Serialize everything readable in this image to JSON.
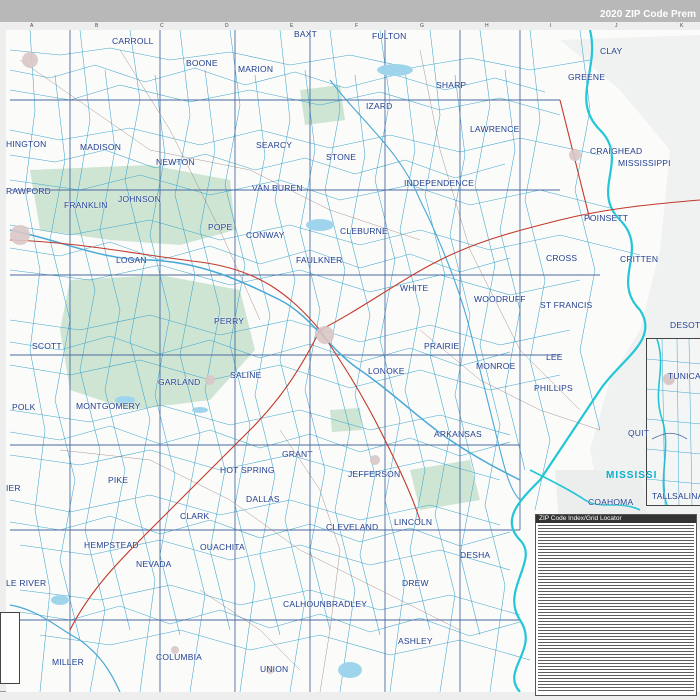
{
  "title": "2020 ZIP Code Prem",
  "grid_letters_top": [
    "A",
    "B",
    "C",
    "D",
    "E",
    "F",
    "G",
    "H",
    "I",
    "J",
    "K"
  ],
  "counties": [
    {
      "id": "carroll",
      "label": "CARROLL"
    },
    {
      "id": "boone",
      "label": "BOONE"
    },
    {
      "id": "marion",
      "label": "MARION"
    },
    {
      "id": "baxter",
      "label": "BAXT"
    },
    {
      "id": "fulton",
      "label": "FULTON"
    },
    {
      "id": "sharp",
      "label": "SHARP"
    },
    {
      "id": "izard",
      "label": "IZARD"
    },
    {
      "id": "greene",
      "label": "GREENE"
    },
    {
      "id": "clay",
      "label": "CLAY"
    },
    {
      "id": "madison",
      "label": "MADISON"
    },
    {
      "id": "washington",
      "label": "HINGTON"
    },
    {
      "id": "newton",
      "label": "NEWTON"
    },
    {
      "id": "searcy",
      "label": "SEARCY"
    },
    {
      "id": "stone",
      "label": "STONE"
    },
    {
      "id": "lawrence",
      "label": "LAWRENCE"
    },
    {
      "id": "craighead",
      "label": "CRAIGHEAD"
    },
    {
      "id": "mississippi",
      "label": "MISSISSIPPI"
    },
    {
      "id": "crawford",
      "label": "RAWFORD"
    },
    {
      "id": "franklin",
      "label": "FRANKLIN"
    },
    {
      "id": "johnson",
      "label": "JOHNSON"
    },
    {
      "id": "van-buren",
      "label": "VAN BUREN"
    },
    {
      "id": "independence",
      "label": "INDEPENDENCE"
    },
    {
      "id": "poinsett",
      "label": "POINSETT"
    },
    {
      "id": "pope",
      "label": "POPE"
    },
    {
      "id": "conway",
      "label": "CONWAY"
    },
    {
      "id": "cleburne",
      "label": "CLEBURNE"
    },
    {
      "id": "faulkner",
      "label": "FAULKNER"
    },
    {
      "id": "logan",
      "label": "LOGAN"
    },
    {
      "id": "white",
      "label": "WHITE"
    },
    {
      "id": "woodruff",
      "label": "WOODRUFF"
    },
    {
      "id": "cross",
      "label": "CROSS"
    },
    {
      "id": "crittenden",
      "label": "CRITTEN"
    },
    {
      "id": "st-francis",
      "label": "ST FRANCIS"
    },
    {
      "id": "perry",
      "label": "PERRY"
    },
    {
      "id": "scott",
      "label": "SCOTT"
    },
    {
      "id": "prairie",
      "label": "PRAIRIE"
    },
    {
      "id": "lonoke",
      "label": "LONOKE"
    },
    {
      "id": "monroe",
      "label": "MONROE"
    },
    {
      "id": "lee",
      "label": "LEE"
    },
    {
      "id": "phillips",
      "label": "PHILLIPS"
    },
    {
      "id": "desoto",
      "label": "DESOTO"
    },
    {
      "id": "garland",
      "label": "GARLAND"
    },
    {
      "id": "saline",
      "label": "SALINE"
    },
    {
      "id": "polk",
      "label": "POLK"
    },
    {
      "id": "montgomery",
      "label": "MONTGOMERY"
    },
    {
      "id": "arkansas",
      "label": "ARKANSAS"
    },
    {
      "id": "grant",
      "label": "GRANT"
    },
    {
      "id": "hot-spring",
      "label": "HOT SPRING"
    },
    {
      "id": "jefferson",
      "label": "JEFFERSON"
    },
    {
      "id": "pike",
      "label": "PIKE"
    },
    {
      "id": "dallas",
      "label": "DALLAS"
    },
    {
      "id": "clark",
      "label": "CLARK"
    },
    {
      "id": "cleveland",
      "label": "CLEVELAND"
    },
    {
      "id": "lincoln",
      "label": "LINCOLN"
    },
    {
      "id": "hempstead",
      "label": "HEMPSTEAD"
    },
    {
      "id": "nevada",
      "label": "NEVADA"
    },
    {
      "id": "ouachita",
      "label": "OUACHITA"
    },
    {
      "id": "desha",
      "label": "DESHA"
    },
    {
      "id": "drew",
      "label": "DREW"
    },
    {
      "id": "bradley",
      "label": "BRADLEY"
    },
    {
      "id": "ashley",
      "label": "ASHLEY"
    },
    {
      "id": "miller",
      "label": "MILLER"
    },
    {
      "id": "columbia",
      "label": "COLUMBIA"
    },
    {
      "id": "union",
      "label": "UNION"
    },
    {
      "id": "little-river",
      "label": "LE RIVER"
    },
    {
      "id": "tunica",
      "label": "TUNICA"
    },
    {
      "id": "coahoma",
      "label": "COAHOMA"
    },
    {
      "id": "tallahatchie",
      "label": "TALL"
    },
    {
      "id": "quitman",
      "label": "QUIT"
    },
    {
      "id": "calhoun",
      "label": "CALHOUN"
    },
    {
      "id": "sevier",
      "label": "IER"
    },
    {
      "id": "salina",
      "label": "SALINA"
    }
  ],
  "river_label": "MISSISSI",
  "index_title": "ZIP Code Index/Grid Locator",
  "colors": {
    "title_bar": "#b8b8b8",
    "river": "#20c7d8",
    "zip_line": "#3aa0c8",
    "road": "#c0392b",
    "public_land": "#c6dfcb",
    "county_text": "#1f3d8f"
  }
}
